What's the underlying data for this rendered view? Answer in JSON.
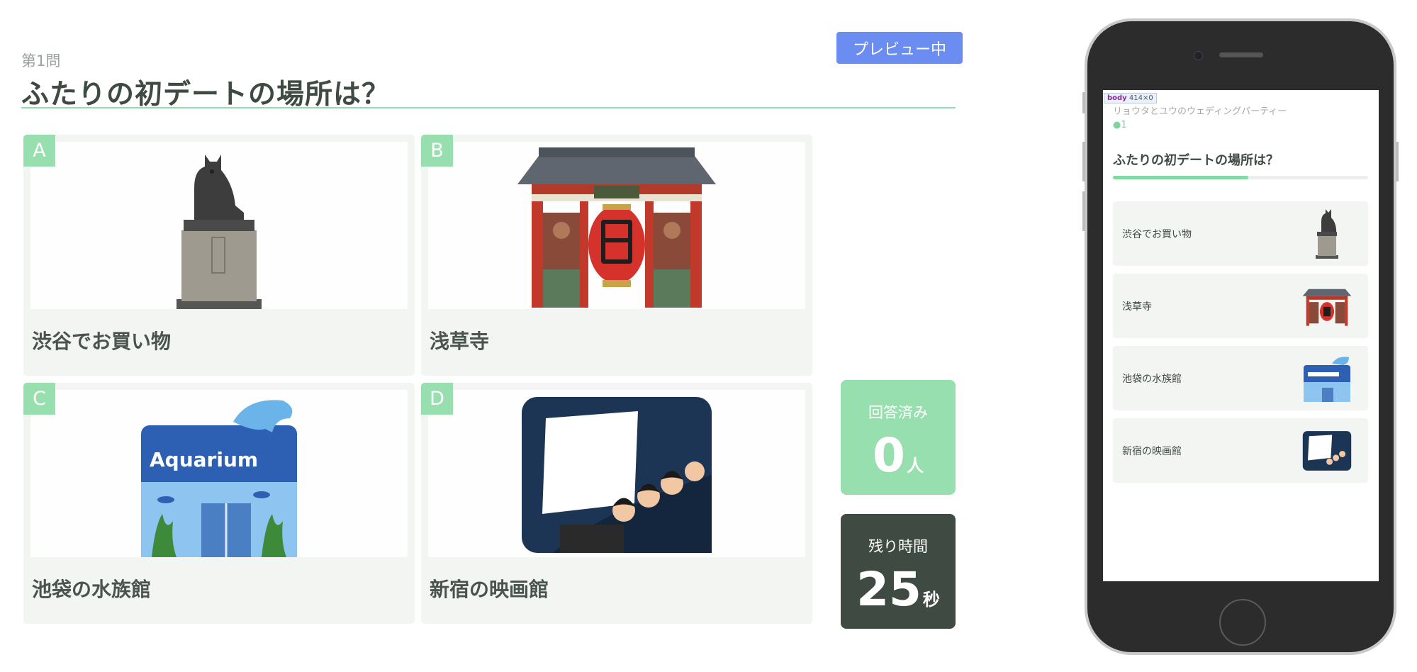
{
  "header": {
    "question_number": "第1問",
    "question_title": "ふたりの初デートの場所は？",
    "preview_label": "プレビュー中"
  },
  "options": [
    {
      "letter": "A",
      "label": "渋谷でお買い物",
      "icon": "hachiko-statue-icon"
    },
    {
      "letter": "B",
      "label": "浅草寺",
      "icon": "kaminarimon-gate-icon"
    },
    {
      "letter": "C",
      "label": "池袋の水族館",
      "icon": "aquarium-building-icon",
      "sign": "Aquarium"
    },
    {
      "letter": "D",
      "label": "新宿の映画館",
      "icon": "movie-theater-icon"
    }
  ],
  "stats": {
    "answered_label": "回答済み",
    "answered_value": "0",
    "answered_unit": "人",
    "remaining_label": "残り時間",
    "remaining_value": "25",
    "remaining_unit": "秒"
  },
  "phone": {
    "devtools_tag": "body",
    "devtools_size": "414×0",
    "event_name": "リョウタとユウのウェディングパーティー",
    "participants": "1",
    "question_title": "ふたりの初デートの場所は？",
    "progress_fraction": 0.53,
    "items": [
      {
        "label": "渋谷でお買い物"
      },
      {
        "label": "浅草寺"
      },
      {
        "label": "池袋の水族館"
      },
      {
        "label": "新宿の映画館"
      }
    ]
  },
  "colors": {
    "accent_green": "#98dfb0",
    "preview_blue": "#6b8cf0",
    "timer_bg": "#3e4a42"
  }
}
